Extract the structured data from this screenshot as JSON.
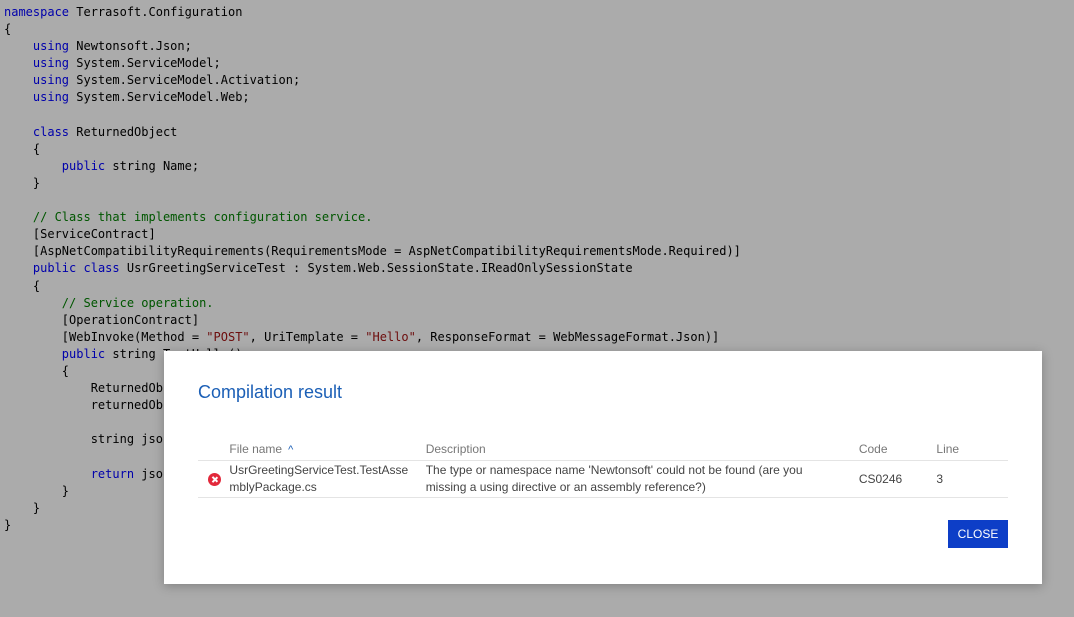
{
  "code_editor": {
    "lines": [
      [
        {
          "t": "kw",
          "v": "namespace"
        },
        {
          "t": "txt",
          "v": " Terrasoft.Configuration"
        }
      ],
      [
        {
          "t": "txt",
          "v": "{"
        }
      ],
      [
        {
          "t": "txt",
          "v": "    "
        },
        {
          "t": "kw",
          "v": "using"
        },
        {
          "t": "txt",
          "v": " Newtonsoft.Json;"
        }
      ],
      [
        {
          "t": "txt",
          "v": "    "
        },
        {
          "t": "kw",
          "v": "using"
        },
        {
          "t": "txt",
          "v": " System.ServiceModel;"
        }
      ],
      [
        {
          "t": "txt",
          "v": "    "
        },
        {
          "t": "kw",
          "v": "using"
        },
        {
          "t": "txt",
          "v": " System.ServiceModel.Activation;"
        }
      ],
      [
        {
          "t": "txt",
          "v": "    "
        },
        {
          "t": "kw",
          "v": "using"
        },
        {
          "t": "txt",
          "v": " System.ServiceModel.Web;"
        }
      ],
      [
        {
          "t": "txt",
          "v": ""
        }
      ],
      [
        {
          "t": "txt",
          "v": "    "
        },
        {
          "t": "kw",
          "v": "class"
        },
        {
          "t": "txt",
          "v": " ReturnedObject"
        }
      ],
      [
        {
          "t": "txt",
          "v": "    {"
        }
      ],
      [
        {
          "t": "txt",
          "v": "        "
        },
        {
          "t": "kw",
          "v": "public"
        },
        {
          "t": "txt",
          "v": " string Name;"
        }
      ],
      [
        {
          "t": "txt",
          "v": "    }"
        }
      ],
      [
        {
          "t": "txt",
          "v": ""
        }
      ],
      [
        {
          "t": "txt",
          "v": "    "
        },
        {
          "t": "cm",
          "v": "// Class that implements configuration service."
        }
      ],
      [
        {
          "t": "txt",
          "v": "    [ServiceContract]"
        }
      ],
      [
        {
          "t": "txt",
          "v": "    [AspNetCompatibilityRequirements(RequirementsMode = AspNetCompatibilityRequirementsMode.Required)]"
        }
      ],
      [
        {
          "t": "txt",
          "v": "    "
        },
        {
          "t": "kw",
          "v": "public"
        },
        {
          "t": "txt",
          "v": " "
        },
        {
          "t": "kw",
          "v": "class"
        },
        {
          "t": "txt",
          "v": " UsrGreetingServiceTest : System.Web.SessionState.IReadOnlySessionState"
        }
      ],
      [
        {
          "t": "txt",
          "v": "    {"
        }
      ],
      [
        {
          "t": "txt",
          "v": "        "
        },
        {
          "t": "cm",
          "v": "// Service operation."
        }
      ],
      [
        {
          "t": "txt",
          "v": "        [OperationContract]"
        }
      ],
      [
        {
          "t": "txt",
          "v": "        [WebInvoke(Method = "
        },
        {
          "t": "str",
          "v": "\"POST\""
        },
        {
          "t": "txt",
          "v": ", UriTemplate = "
        },
        {
          "t": "str",
          "v": "\"Hello\""
        },
        {
          "t": "txt",
          "v": ", ResponseFormat = WebMessageFormat.Json)]"
        }
      ],
      [
        {
          "t": "txt",
          "v": "        "
        },
        {
          "t": "kw",
          "v": "public"
        },
        {
          "t": "txt",
          "v": " string TestHello()"
        }
      ],
      [
        {
          "t": "txt",
          "v": "        {"
        }
      ],
      [
        {
          "t": "txt",
          "v": "            ReturnedObject"
        }
      ],
      [
        {
          "t": "txt",
          "v": "            returnedObject"
        }
      ],
      [
        {
          "t": "txt",
          "v": ""
        }
      ],
      [
        {
          "t": "txt",
          "v": "            string json"
        }
      ],
      [
        {
          "t": "txt",
          "v": ""
        }
      ],
      [
        {
          "t": "txt",
          "v": "            "
        },
        {
          "t": "kw",
          "v": "return"
        },
        {
          "t": "txt",
          "v": " json"
        }
      ],
      [
        {
          "t": "txt",
          "v": "        }"
        }
      ],
      [
        {
          "t": "txt",
          "v": "    }"
        }
      ],
      [
        {
          "t": "txt",
          "v": "}"
        }
      ]
    ]
  },
  "dialog": {
    "title": "Compilation result",
    "columns": {
      "file_name": "File name",
      "description": "Description",
      "code": "Code",
      "line": "Line"
    },
    "sort_indicator": "^",
    "rows": [
      {
        "status_icon": "error-circle-icon",
        "file_name": "UsrGreetingServiceTest.TestAssemblyPackage.cs",
        "description": "The type or namespace name 'Newtonsoft' could not be found (are you missing a using directive or an assembly reference?)",
        "code": "CS0246",
        "line": "3"
      }
    ],
    "close_label": "CLOSE"
  },
  "colors": {
    "accent": "#1b5fb6",
    "button": "#0d3ec7",
    "error": "#e2293b",
    "keyword": "#0000ff",
    "string": "#a31515",
    "comment": "#008000"
  }
}
